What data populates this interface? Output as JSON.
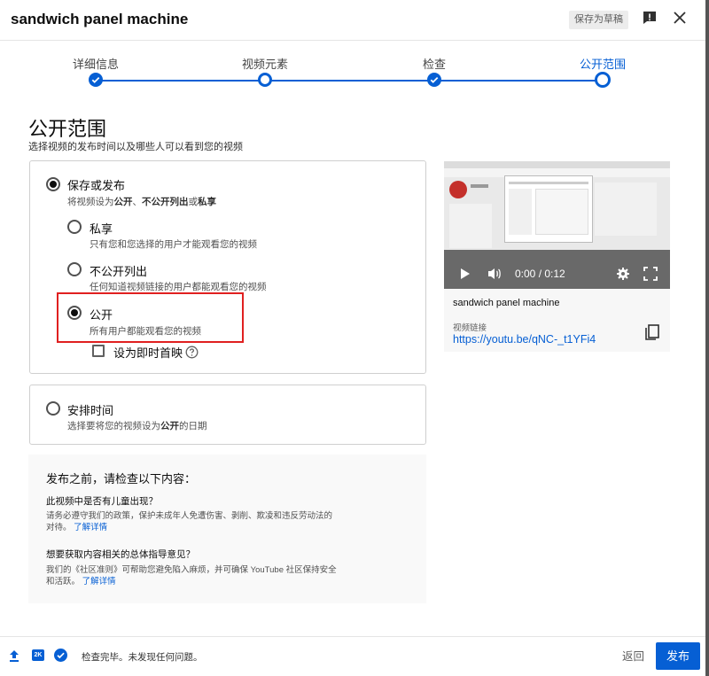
{
  "dialog": {
    "title": "sandwich panel machine",
    "save_draft": "保存为草稿"
  },
  "stepper": {
    "steps": [
      {
        "label": "详细信息",
        "state": "done"
      },
      {
        "label": "视频元素",
        "state": "open"
      },
      {
        "label": "检查",
        "state": "done"
      },
      {
        "label": "公开范围",
        "state": "current"
      }
    ]
  },
  "visibility": {
    "title": "公开范围",
    "subtitle": "选择视频的发布时间以及哪些人可以看到您的视频",
    "save_or_publish": {
      "label": "保存或发布",
      "desc_prefix": "将视频设为",
      "desc_public": "公开",
      "desc_sep": "、",
      "desc_unlisted": "不公开列出",
      "desc_or": "或",
      "desc_private": "私享",
      "selected": true
    },
    "options": [
      {
        "label": "私享",
        "desc": "只有您和您选择的用户才能观看您的视频",
        "selected": false
      },
      {
        "label": "不公开列出",
        "desc": "任何知道视频链接的用户都能观看您的视频",
        "selected": false
      },
      {
        "label": "公开",
        "desc": "所有用户都能观看您的视频",
        "selected": true
      }
    ],
    "premiere": {
      "label": "设为即时首映",
      "checked": false
    },
    "schedule": {
      "label": "安排时间",
      "desc_prefix": "选择要将您的视频设为",
      "desc_bold": "公开",
      "desc_suffix": "的日期",
      "selected": false
    }
  },
  "preview": {
    "time": "0:00 / 0:12",
    "video_title": "sandwich panel machine",
    "link_label": "视频链接",
    "link": "https://youtu.be/qNC-_t1YFi4"
  },
  "checklist": {
    "title": "发布之前，请检查以下内容：",
    "q1": "此视频中是否有儿童出现？",
    "t1_line1": "请务必遵守我们的政策，保护未成年人免遭伤害、剥削、欺凌和违反劳动法的",
    "t1_line2": "对待。",
    "t1_link": "了解详情",
    "q2": "想要获取内容相关的总体指导意见？",
    "t2_line1": "我们的《社区准则》可帮助您避免陷入麻烦，并可确保 YouTube 社区保持安全",
    "t2_line2": "和活跃。",
    "t2_link": "了解详情"
  },
  "footer": {
    "hd_badge": "2K",
    "status": "检查完毕。未发现任何问题。",
    "back": "返回",
    "publish": "发布"
  },
  "colors": {
    "accent": "#065fd4",
    "highlight": "#e02020"
  }
}
